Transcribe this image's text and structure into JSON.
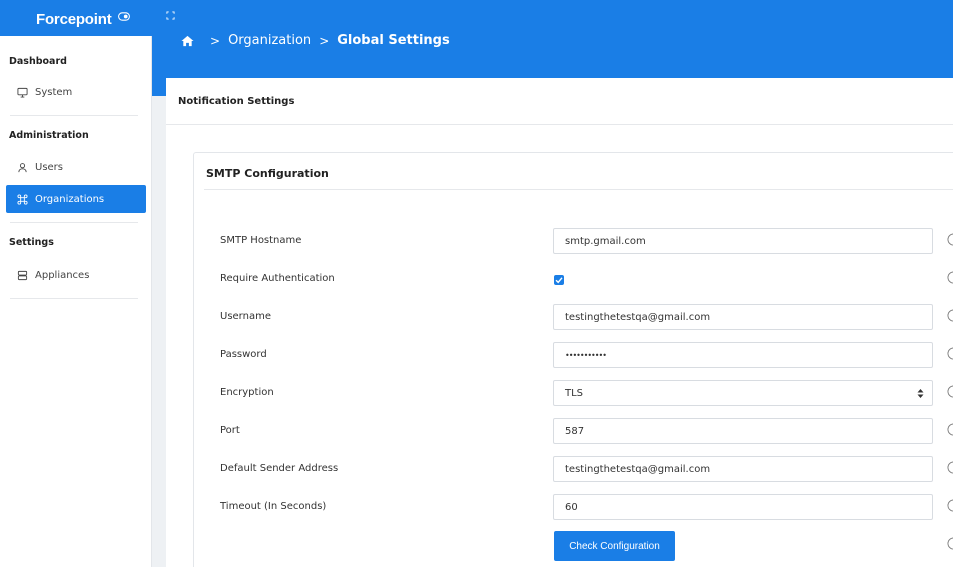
{
  "brand": {
    "name": "Forcepoint"
  },
  "breadcrumb": {
    "level1": "Organization",
    "level2": "Global Settings",
    "separator": ">"
  },
  "sidebar": {
    "sections": [
      {
        "title": "Dashboard",
        "items": [
          {
            "label": "System",
            "icon": "monitor-icon"
          }
        ]
      },
      {
        "title": "Administration",
        "items": [
          {
            "label": "Users",
            "icon": "user-icon"
          },
          {
            "label": "Organizations",
            "icon": "command-icon",
            "active": true
          }
        ]
      },
      {
        "title": "Settings",
        "items": [
          {
            "label": "Appliances",
            "icon": "server-icon"
          }
        ]
      }
    ]
  },
  "panel": {
    "title": "Notification Settings"
  },
  "smtp": {
    "title": "SMTP Configuration",
    "hostname": {
      "label": "SMTP Hostname",
      "value": "smtp.gmail.com"
    },
    "require_auth": {
      "label": "Require Authentication",
      "checked": true
    },
    "username": {
      "label": "Username",
      "value": "testingthetestqa@gmail.com"
    },
    "password": {
      "label": "Password",
      "value": "•••••••••••"
    },
    "encryption": {
      "label": "Encryption",
      "value": "TLS"
    },
    "port": {
      "label": "Port",
      "value": "587"
    },
    "sender": {
      "label": "Default Sender Address",
      "value": "testingthetestqa@gmail.com"
    },
    "timeout": {
      "label": "Timeout (In Seconds)",
      "value": "60"
    },
    "check_button": "Check Configuration"
  },
  "colors": {
    "accent": "#1a7ee6",
    "background": "#eef1f4",
    "panel": "#ffffff"
  }
}
